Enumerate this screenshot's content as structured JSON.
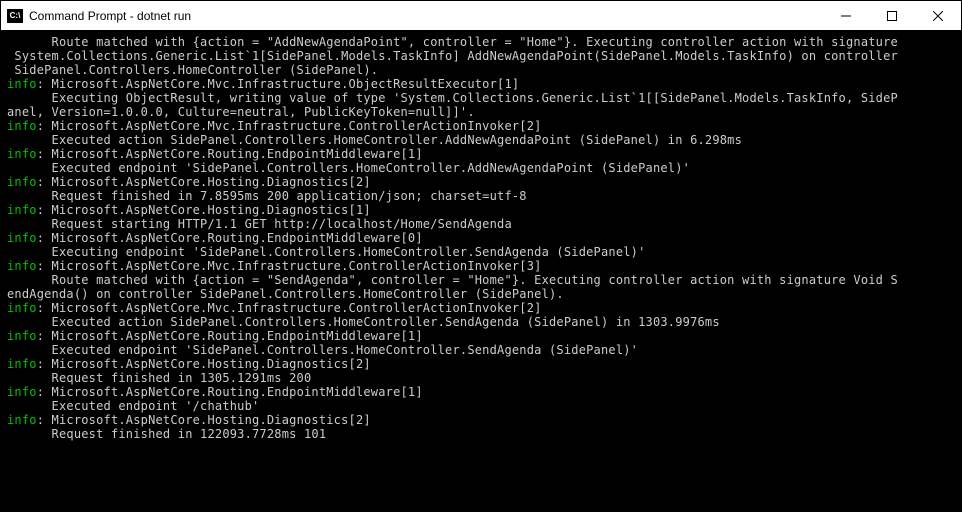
{
  "window": {
    "icon_text": "C:\\",
    "title": "Command Prompt - dotnet  run"
  },
  "info_prefix": "info",
  "lines": [
    {
      "type": "plain",
      "text": "      Route matched with {action = \"AddNewAgendaPoint\", controller = \"Home\"}. Executing controller action with signature"
    },
    {
      "type": "plain",
      "text": " System.Collections.Generic.List`1[SidePanel.Models.TaskInfo] AddNewAgendaPoint(SidePanel.Models.TaskInfo) on controller"
    },
    {
      "type": "plain",
      "text": " SidePanel.Controllers.HomeController (SidePanel)."
    },
    {
      "type": "info",
      "text": ": Microsoft.AspNetCore.Mvc.Infrastructure.ObjectResultExecutor[1]"
    },
    {
      "type": "plain",
      "text": "      Executing ObjectResult, writing value of type 'System.Collections.Generic.List`1[[SidePanel.Models.TaskInfo, SideP"
    },
    {
      "type": "plain",
      "text": "anel, Version=1.0.0.0, Culture=neutral, PublicKeyToken=null]]'."
    },
    {
      "type": "info",
      "text": ": Microsoft.AspNetCore.Mvc.Infrastructure.ControllerActionInvoker[2]"
    },
    {
      "type": "plain",
      "text": "      Executed action SidePanel.Controllers.HomeController.AddNewAgendaPoint (SidePanel) in 6.298ms"
    },
    {
      "type": "info",
      "text": ": Microsoft.AspNetCore.Routing.EndpointMiddleware[1]"
    },
    {
      "type": "plain",
      "text": "      Executed endpoint 'SidePanel.Controllers.HomeController.AddNewAgendaPoint (SidePanel)'"
    },
    {
      "type": "info",
      "text": ": Microsoft.AspNetCore.Hosting.Diagnostics[2]"
    },
    {
      "type": "plain",
      "text": "      Request finished in 7.8595ms 200 application/json; charset=utf-8"
    },
    {
      "type": "info",
      "text": ": Microsoft.AspNetCore.Hosting.Diagnostics[1]"
    },
    {
      "type": "plain",
      "text": "      Request starting HTTP/1.1 GET http://localhost/Home/SendAgenda"
    },
    {
      "type": "info",
      "text": ": Microsoft.AspNetCore.Routing.EndpointMiddleware[0]"
    },
    {
      "type": "plain",
      "text": "      Executing endpoint 'SidePanel.Controllers.HomeController.SendAgenda (SidePanel)'"
    },
    {
      "type": "info",
      "text": ": Microsoft.AspNetCore.Mvc.Infrastructure.ControllerActionInvoker[3]"
    },
    {
      "type": "plain",
      "text": "      Route matched with {action = \"SendAgenda\", controller = \"Home\"}. Executing controller action with signature Void S"
    },
    {
      "type": "plain",
      "text": "endAgenda() on controller SidePanel.Controllers.HomeController (SidePanel)."
    },
    {
      "type": "info",
      "text": ": Microsoft.AspNetCore.Mvc.Infrastructure.ControllerActionInvoker[2]"
    },
    {
      "type": "plain",
      "text": "      Executed action SidePanel.Controllers.HomeController.SendAgenda (SidePanel) in 1303.9976ms"
    },
    {
      "type": "info",
      "text": ": Microsoft.AspNetCore.Routing.EndpointMiddleware[1]"
    },
    {
      "type": "plain",
      "text": "      Executed endpoint 'SidePanel.Controllers.HomeController.SendAgenda (SidePanel)'"
    },
    {
      "type": "info",
      "text": ": Microsoft.AspNetCore.Hosting.Diagnostics[2]"
    },
    {
      "type": "plain",
      "text": "      Request finished in 1305.1291ms 200"
    },
    {
      "type": "info",
      "text": ": Microsoft.AspNetCore.Routing.EndpointMiddleware[1]"
    },
    {
      "type": "plain",
      "text": "      Executed endpoint '/chathub'"
    },
    {
      "type": "info",
      "text": ": Microsoft.AspNetCore.Hosting.Diagnostics[2]"
    },
    {
      "type": "plain",
      "text": "      Request finished in 122093.7728ms 101"
    }
  ]
}
